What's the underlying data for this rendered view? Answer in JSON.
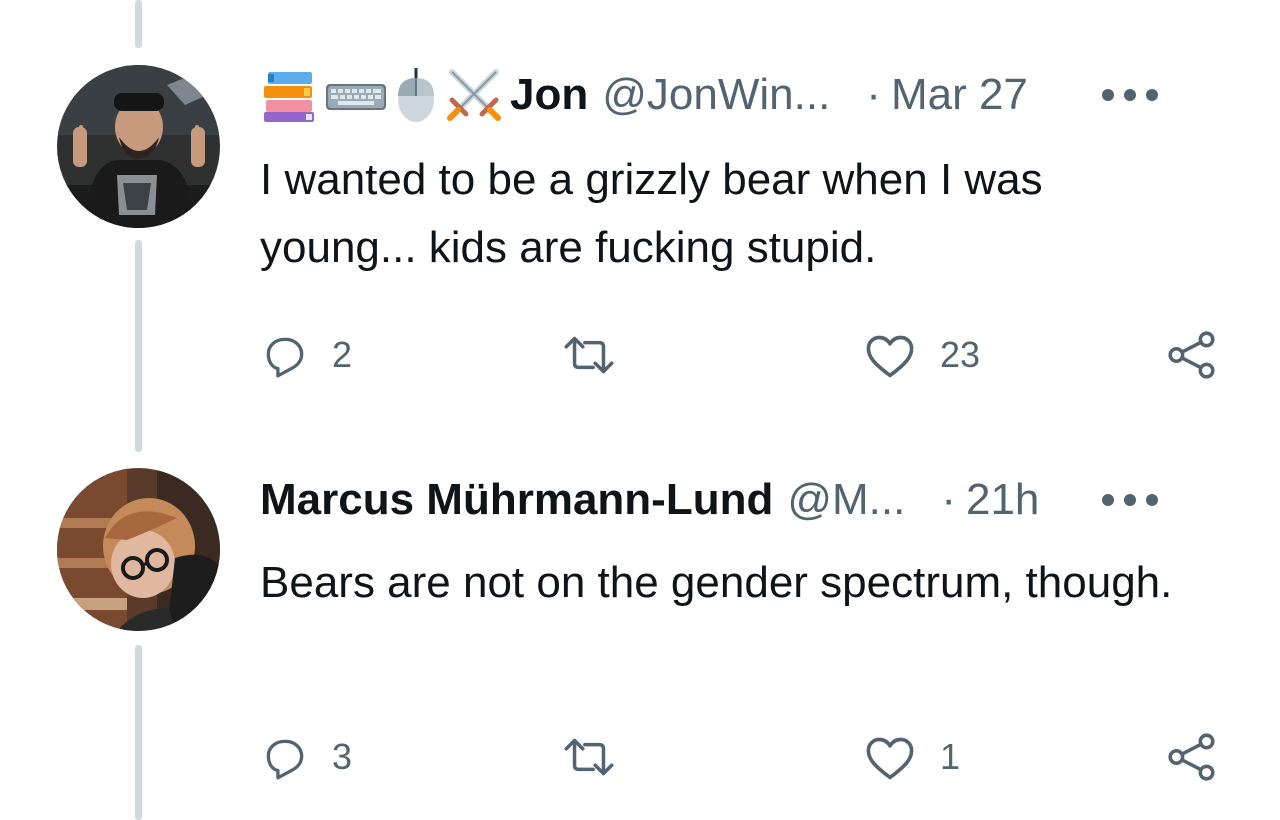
{
  "tweets": [
    {
      "badge_icons": [
        "books-emoji",
        "keyboard-emoji",
        "mouse-emoji",
        "crossed-swords-emoji"
      ],
      "display_name": "Jon",
      "handle": "@JonWin...",
      "separator": "·",
      "time": "Mar 27",
      "text": "I wanted to be a grizzly bear when I was young... kids are fucking stupid.",
      "reply_count": "2",
      "retweet_count": "",
      "like_count": "23"
    },
    {
      "badge_icons": [],
      "display_name": "Marcus Mührmann-Lund",
      "handle": "@M...",
      "separator": "·",
      "time": "21h",
      "text": "Bears are not on the gender spectrum, though.",
      "reply_count": "3",
      "retweet_count": "",
      "like_count": "1"
    }
  ],
  "icons": {
    "reply": "reply-icon",
    "retweet": "retweet-icon",
    "like": "heart-icon",
    "share": "share-icon",
    "more": "more-icon"
  },
  "colors": {
    "text_primary": "#0f1419",
    "text_secondary": "#536471",
    "thread_line": "#cfd9de"
  }
}
